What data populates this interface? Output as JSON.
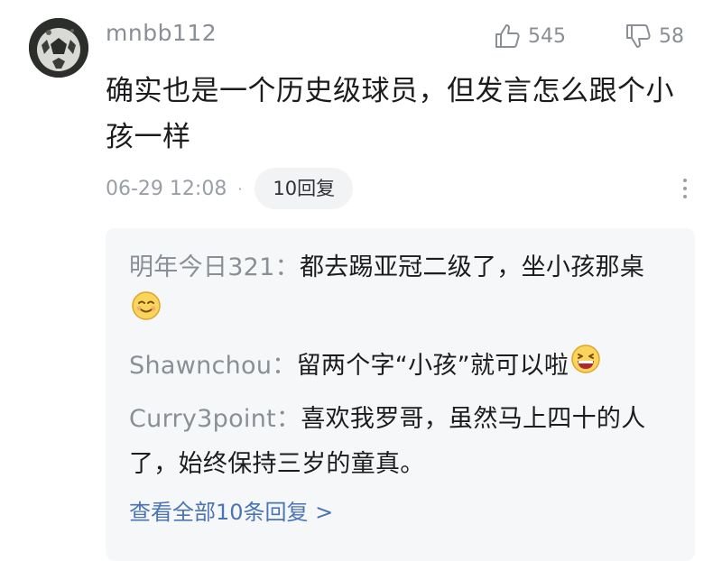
{
  "comment": {
    "username": "mnbb112",
    "like_count": "545",
    "dislike_count": "58",
    "text": "确实也是一个历史级球员，但发言怎么跟个小孩一样",
    "timestamp": "06-29 12:08",
    "separator": "·",
    "reply_button": "10回复",
    "more_icon": "more-vertical-icon"
  },
  "replies": [
    {
      "author": "明年今日321：",
      "text": "都去踢亚冠二级了，坐小孩那桌",
      "emoji": "smirk-face-emoji"
    },
    {
      "author": "Shawnchou：",
      "text": "留两个字“小孩”就可以啦",
      "emoji": "grinning-face-emoji"
    },
    {
      "author": "Curry3point：",
      "text": "喜欢我罗哥，虽然马上四十的人了，始终保持三岁的童真。",
      "emoji": ""
    }
  ],
  "view_all": "查看全部10条回复 >",
  "icons": {
    "like": "thumbs-up-icon",
    "dislike": "thumbs-down-icon"
  },
  "colors": {
    "meta_gray": "#8a8f96",
    "link_blue": "#4b74b4",
    "reply_bg": "#f6f7f9"
  }
}
